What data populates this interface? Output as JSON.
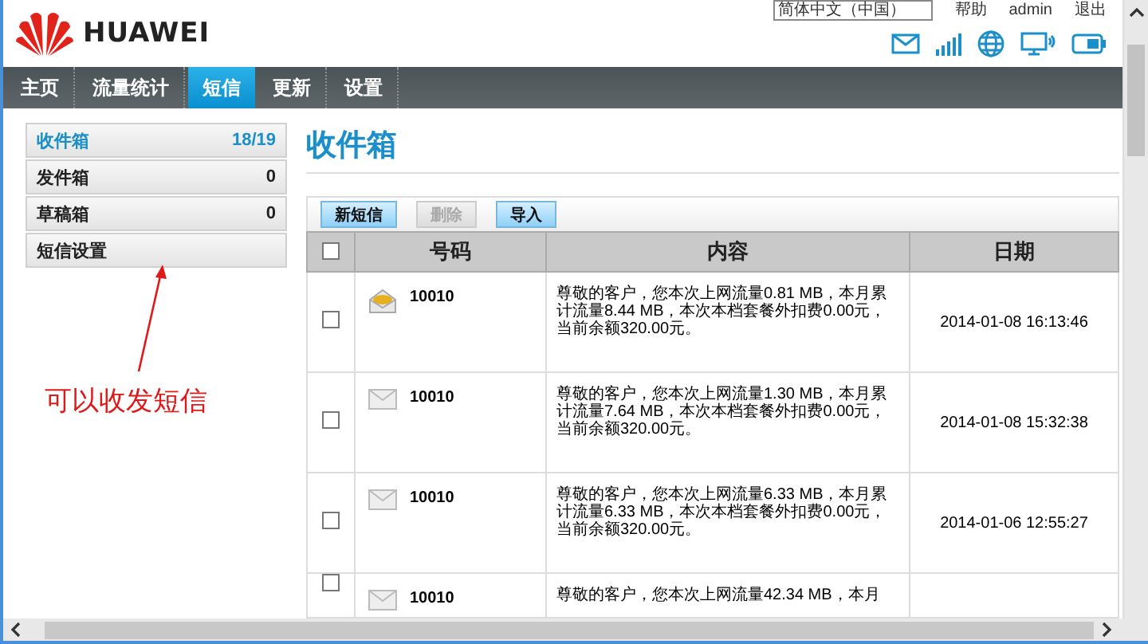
{
  "header": {
    "logo": "HUAWEI",
    "language": "简体中文（中国）",
    "links": [
      "帮助",
      "admin",
      "退出"
    ]
  },
  "nav": [
    {
      "label": "主页",
      "selected": false
    },
    {
      "label": "流量统计",
      "selected": false
    },
    {
      "label": "短信",
      "selected": true
    },
    {
      "label": "更新",
      "selected": false
    },
    {
      "label": "设置",
      "selected": false
    }
  ],
  "sidebar": [
    {
      "label": "收件箱",
      "count": "18/19",
      "selected": true
    },
    {
      "label": "发件箱",
      "count": "0",
      "selected": false
    },
    {
      "label": "草稿箱",
      "count": "0",
      "selected": false
    },
    {
      "label": "短信设置",
      "selected": false
    }
  ],
  "annotation": {
    "text": "可以收发短信"
  },
  "inbox": {
    "title": "收件箱",
    "buttons": [
      {
        "label": "新短信",
        "disabled": false
      },
      {
        "label": "删除",
        "disabled": true
      },
      {
        "label": "导入",
        "disabled": false
      }
    ],
    "select_all": {
      "checked": false
    },
    "columns": [
      "号码",
      "内容",
      "日期"
    ],
    "rows": [
      {
        "checked": false,
        "unread": true,
        "number": "10010",
        "content": "尊敬的客户，您本次上网流量0.81 MB，本月累计流量8.44 MB，本次本档套餐外扣费0.00元，当前余额320.00元。",
        "date": "2014-01-08 16:13:46"
      },
      {
        "checked": false,
        "unread": false,
        "number": "10010",
        "content": "尊敬的客户，您本次上网流量1.30 MB，本月累计流量7.64 MB，本次本档套餐外扣费0.00元，当前余额320.00元。",
        "date": "2014-01-08 15:32:38"
      },
      {
        "checked": false,
        "unread": false,
        "number": "10010",
        "content": "尊敬的客户，您本次上网流量6.33 MB，本月累计流量6.33 MB，本次本档套餐外扣费0.00元，当前余额320.00元。",
        "date": "2014-01-06 12:55:27"
      },
      {
        "checked": false,
        "unread": false,
        "number": "10010",
        "content": "尊敬的客户，您本次上网流量42.34 MB，本月"
      }
    ]
  }
}
